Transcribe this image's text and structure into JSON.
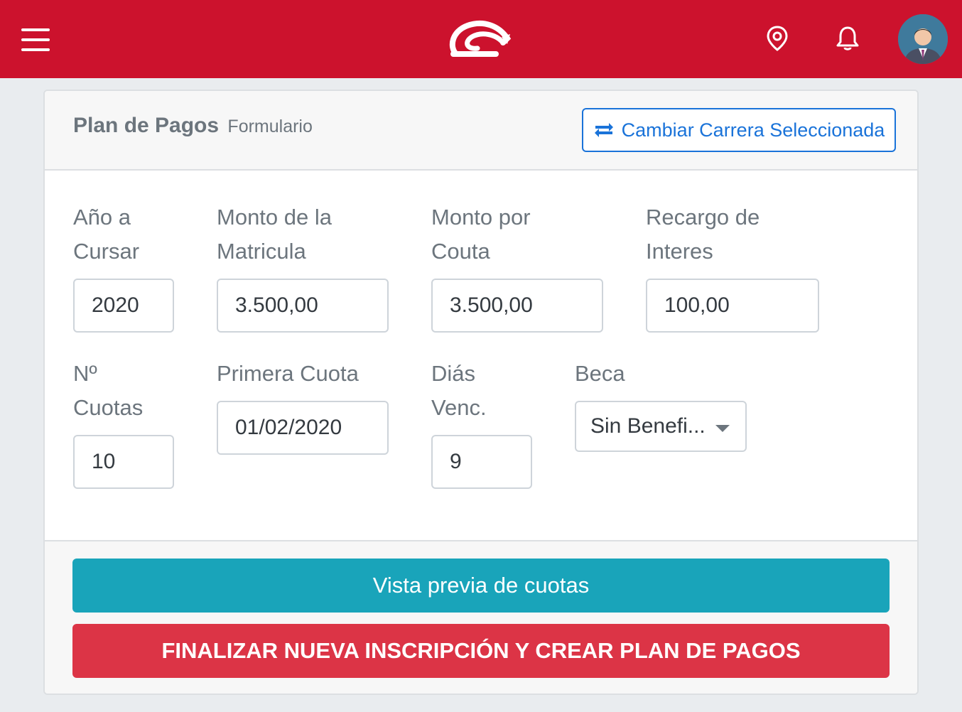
{
  "header": {
    "menu_icon": "hamburger-menu-icon",
    "logo": "brand-logo",
    "location_icon": "map-pin-icon",
    "bell_icon": "bell-icon",
    "avatar": "user-avatar",
    "brand_color": "#cc122d"
  },
  "card": {
    "title": "Plan de Pagos",
    "subtitle": "Formulario",
    "change_button": {
      "label": "Cambiar Carrera Seleccionada",
      "icon": "swap-arrows-icon",
      "color": "#1a73d9"
    }
  },
  "form": {
    "anio": {
      "label_line1": "Año a",
      "label_line2": "Cursar",
      "value": "2020"
    },
    "matricula": {
      "label_line1": "Monto de la",
      "label_line2": "Matricula",
      "value": "3.500,00"
    },
    "cuota": {
      "label_line1": "Monto por",
      "label_line2": "Couta",
      "value": "3.500,00"
    },
    "recargo": {
      "label_line1": "Recargo de",
      "label_line2": "Interes",
      "value": "100,00"
    },
    "n_cuotas": {
      "label_line1": "Nº",
      "label_line2": "Cuotas",
      "value": "10"
    },
    "primera_cuota": {
      "label": "Primera Cuota",
      "value": "01/02/2020"
    },
    "dias_venc": {
      "label_line1": "Diás",
      "label_line2": "Venc.",
      "value": "9"
    },
    "beca": {
      "label": "Beca",
      "selected": "Sin Benefi..."
    }
  },
  "actions": {
    "preview_label": "Vista previa de cuotas",
    "preview_color": "#19a4ba",
    "finalize_label": "FINALIZAR NUEVA INSCRIPCIÓN Y CREAR PLAN DE PAGOS",
    "finalize_color": "#dc3446"
  }
}
